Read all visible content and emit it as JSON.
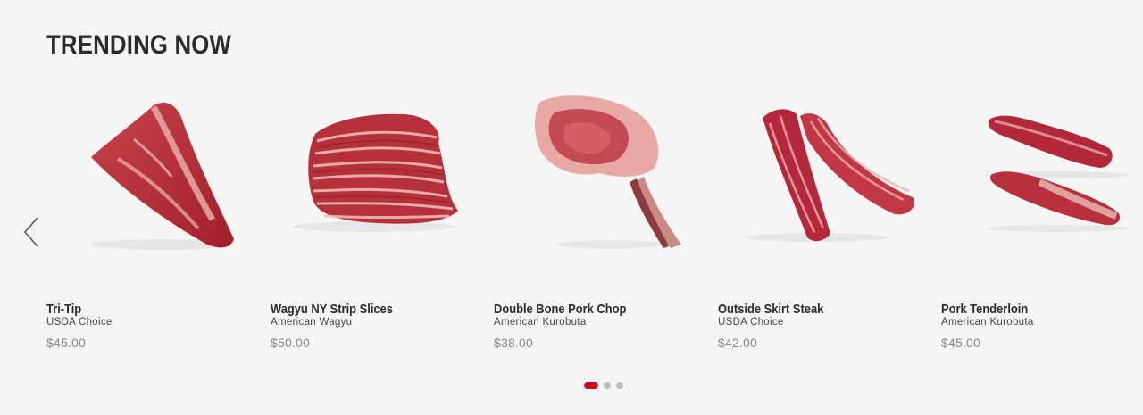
{
  "section": {
    "title": "TRENDING NOW"
  },
  "carousel": {
    "prev_icon": "chevron-left-icon",
    "products": [
      {
        "name": "Tri-Tip",
        "grade": "USDA Choice",
        "price": "$45.00",
        "image": "tri-tip-image"
      },
      {
        "name": "Wagyu NY Strip Slices",
        "grade": "American Wagyu",
        "price": "$50.00",
        "image": "wagyu-strip-slices-image"
      },
      {
        "name": "Double Bone Pork Chop",
        "grade": "American Kurobuta",
        "price": "$38.00",
        "image": "pork-chop-image"
      },
      {
        "name": "Outside Skirt Steak",
        "grade": "USDA Choice",
        "price": "$42.00",
        "image": "skirt-steak-image"
      },
      {
        "name": "Pork Tenderloin",
        "grade": "American Kurobuta",
        "price": "$45.00",
        "image": "pork-tenderloin-image"
      }
    ],
    "pagination": {
      "pages": 3,
      "active": 1
    }
  },
  "colors": {
    "background": "#f5f5f5",
    "accent": "#cc0a1e",
    "dot_inactive": "#bbbbbb",
    "meat_red": "#b3262f",
    "meat_fat": "#e9b9b6"
  }
}
